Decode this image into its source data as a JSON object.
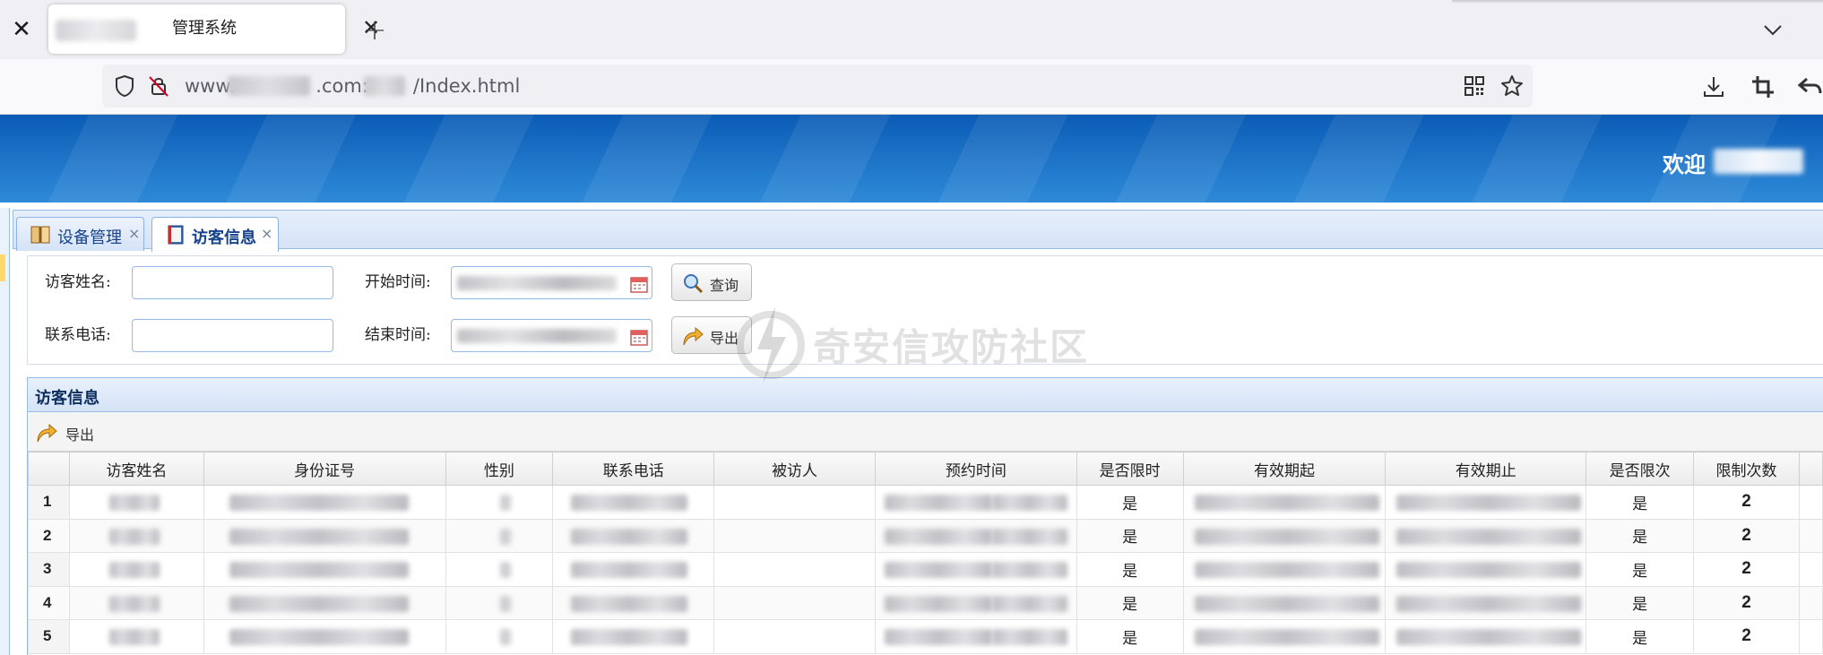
{
  "browser": {
    "tab_title": "管理系统",
    "url_prefix": "www.",
    "url_mid": ".com:",
    "url_suffix": "/Index.html"
  },
  "header": {
    "welcome": "欢迎"
  },
  "tabs": [
    {
      "label": "设备管理",
      "close": "×"
    },
    {
      "label": "访客信息",
      "close": "×"
    }
  ],
  "form": {
    "name_label": "访客姓名:",
    "phone_label": "联系电话:",
    "start_label": "开始时间:",
    "end_label": "结束时间:",
    "query_button": "查询",
    "export_button": "导出",
    "name_value": "",
    "phone_value": ""
  },
  "watermark": "奇安信攻防社区",
  "grid": {
    "title": "访客信息",
    "toolbar_export": "导出",
    "columns": [
      "",
      "访客姓名",
      "身份证号",
      "性别",
      "联系电话",
      "被访人",
      "预约时间",
      "是否限时",
      "有效期起",
      "有效期止",
      "是否限次",
      "限制次数",
      ""
    ],
    "rows": [
      {
        "no": "1",
        "limited_time": "是",
        "limited_count": "是",
        "count": "2"
      },
      {
        "no": "2",
        "limited_time": "是",
        "limited_count": "是",
        "count": "2"
      },
      {
        "no": "3",
        "limited_time": "是",
        "limited_count": "是",
        "count": "2"
      },
      {
        "no": "4",
        "limited_time": "是",
        "limited_count": "是",
        "count": "2"
      },
      {
        "no": "5",
        "limited_time": "是",
        "limited_count": "是",
        "count": "2"
      }
    ]
  },
  "colors": {
    "header_blue": "#1a6fc4",
    "tab_text": "#15428b",
    "panel_border": "#99bbe8"
  }
}
